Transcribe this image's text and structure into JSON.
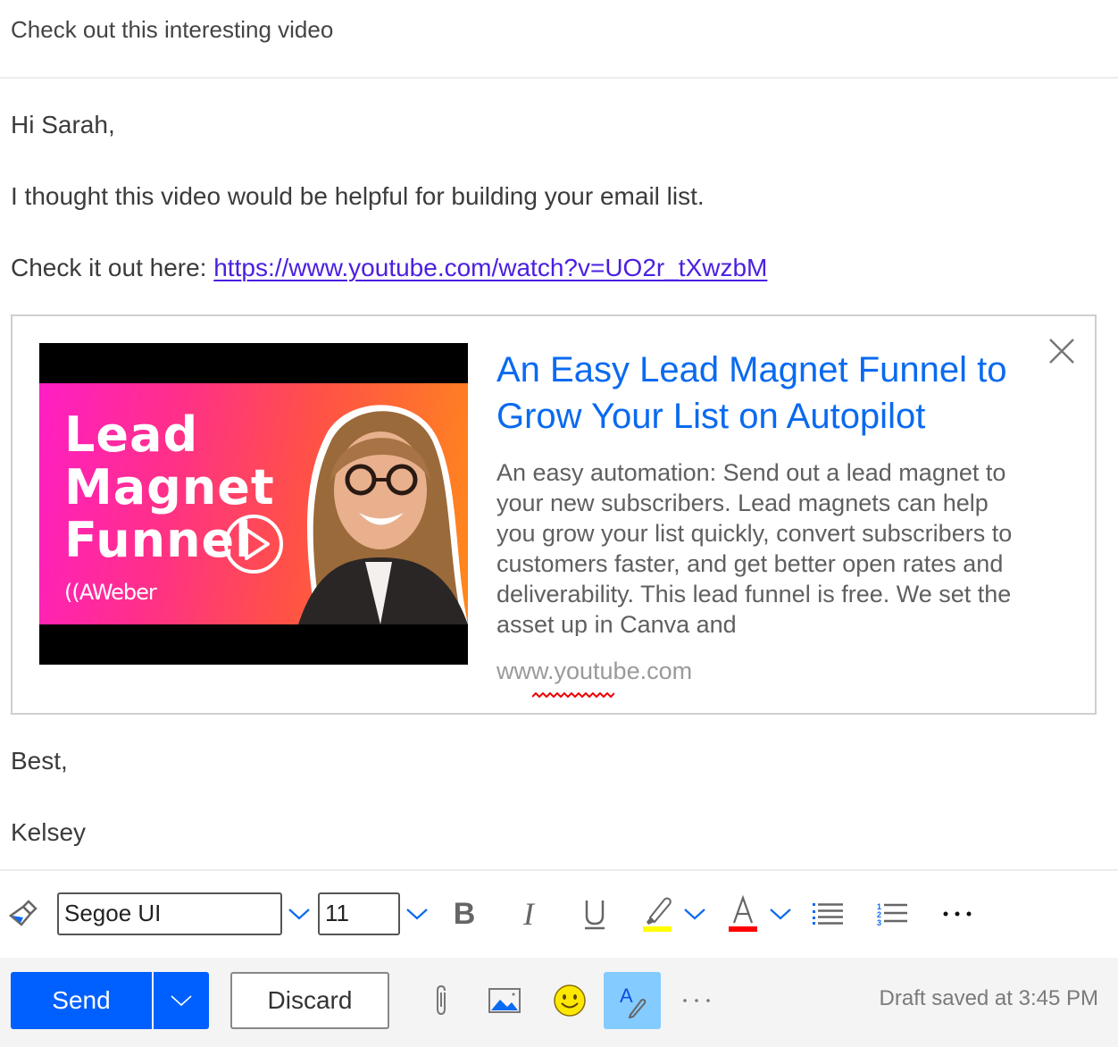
{
  "subject": "Check out this interesting video",
  "body": {
    "greeting": "Hi Sarah,",
    "line1": "I thought this video would be helpful for building your email list.",
    "check_prefix": "Check it out here: ",
    "link_text": "https://www.youtube.com/watch?v=UO2r_tXwzbM",
    "signoff": "Best,",
    "signature": "Kelsey"
  },
  "link_preview": {
    "thumbnail": {
      "title_lines": [
        "Lead",
        "Magnet",
        "Funnel"
      ],
      "brand": "((AWeber",
      "icon": "play-icon"
    },
    "title": "An Easy Lead Magnet Funnel to Grow Your List on Autopilot",
    "description": "An easy automation: Send out a lead magnet to your new subscribers. Lead magnets can help you grow your list quickly, convert subscribers to customers faster, and get better open rates and deliverability. This lead funnel is free. We set the asset up in Canva and",
    "domain": "www.youtube.com",
    "close_icon": "close-icon"
  },
  "format_toolbar": {
    "font_name": "Segoe UI",
    "font_size": "11",
    "icons": [
      "format-painter-icon",
      "bold-icon",
      "italic-icon",
      "underline-icon",
      "highlight-icon",
      "font-color-icon",
      "bullets-icon",
      "numbering-icon",
      "more-icon"
    ],
    "highlight_color": "#ffff00",
    "font_color": "#ff0000"
  },
  "actions": {
    "send_label": "Send",
    "discard_label": "Discard",
    "draft_status": "Draft saved at 3:45 PM",
    "accent": "#0060ff"
  }
}
